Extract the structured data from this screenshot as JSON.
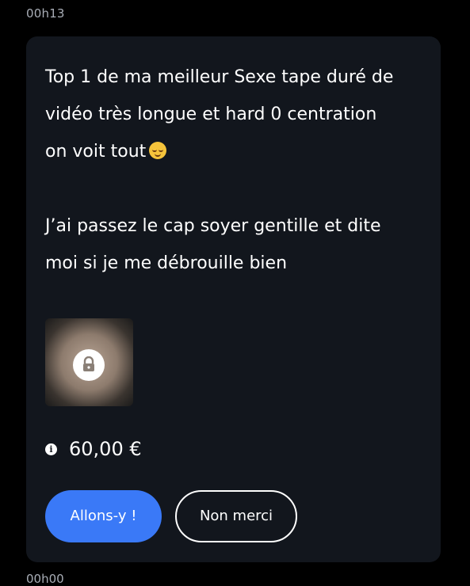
{
  "header": {
    "timestamp": "00h13"
  },
  "footer": {
    "timestamp_partial": "00h00"
  },
  "message": {
    "line1": "Top 1 de ma meilleur Sexe tape duré de",
    "line2": "vidéo très longue et hard 0 centration",
    "line3": "on voit tout",
    "emoji_name": "relieved-face-emoji",
    "paragraph2": "J’ai passez le cap soyer gentille et dite\nmoi si je me débrouille bien"
  },
  "media": {
    "icon": "lock-icon",
    "locked": true
  },
  "offer": {
    "info_icon_label": "i",
    "price": "60,00 €"
  },
  "actions": {
    "accept_label": "Allons-y !",
    "decline_label": "Non merci"
  },
  "colors": {
    "background": "#000000",
    "card": "#12161d",
    "accent": "#3a79f7",
    "muted_text": "#a9aeb7"
  }
}
